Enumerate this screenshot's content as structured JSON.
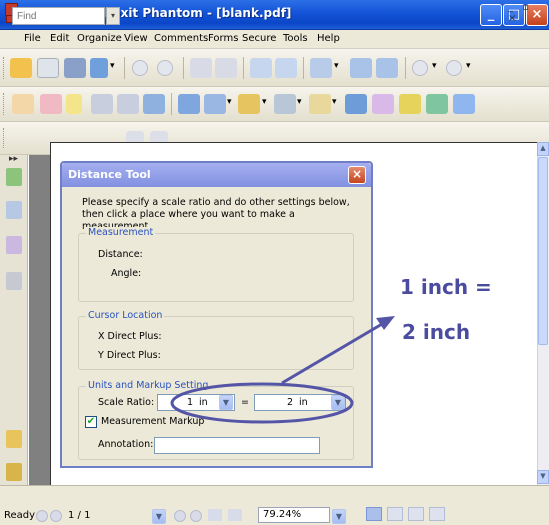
{
  "window": {
    "title": "blank.pdf - Foxit Phantom - [blank.pdf]",
    "controls": {
      "minimize": "_",
      "maximize": "□",
      "close": "×"
    }
  },
  "menubar": {
    "items": [
      "File",
      "Edit",
      "Organize",
      "View",
      "Comments",
      "Forms",
      "Secure",
      "Tools",
      "Help"
    ],
    "mdi_controls": "_ ▫ ×"
  },
  "toolbar": {
    "find_placeholder": "Find",
    "dropdown_glyph": "▾"
  },
  "sidebar": {
    "collapse_glyph": "▸▸"
  },
  "dialog": {
    "title": "Distance Tool",
    "close_glyph": "×",
    "instructions": "Please specify a scale ratio and do other settings below, then click a place where you want to make a measurement.",
    "measurement": {
      "label": "Measurement",
      "distance_label": "Distance:",
      "angle_label": "Angle:"
    },
    "cursor_location": {
      "label": "Cursor Location",
      "x_label": "X Direct Plus:",
      "y_label": "Y Direct Plus:"
    },
    "units": {
      "label": "Units and Markup Setting",
      "scale_ratio_label": "Scale Ratio:",
      "left_value": "1",
      "left_unit": "in",
      "equals": "=",
      "right_value": "2",
      "right_unit": "in",
      "markup_checkbox_label": "Measurement Markup",
      "markup_checked": true,
      "annotation_label": "Annotation:",
      "annotation_value": ""
    }
  },
  "overlay": {
    "line1": "1 inch =",
    "line2": "2 inch",
    "color": "#4b4ba0"
  },
  "statusbar": {
    "status": "Ready",
    "page": "1 / 1",
    "zoom": "79.24%"
  }
}
